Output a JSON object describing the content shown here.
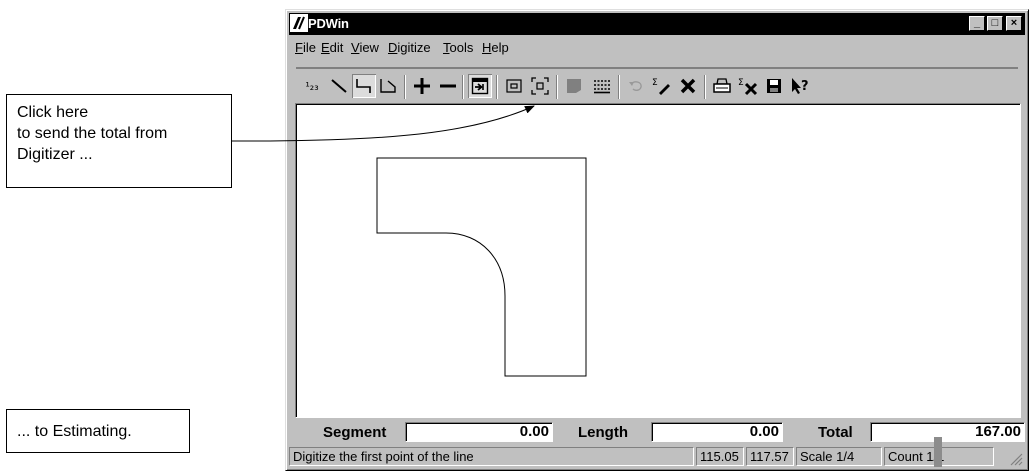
{
  "callouts": {
    "top": [
      "Click here",
      "to send the total from",
      "Digitizer ..."
    ],
    "bottom": "... to Estimating."
  },
  "window": {
    "title": "PDWin",
    "buttons": {
      "minimize": "_",
      "maximize": "□",
      "close": "×"
    }
  },
  "menu": [
    {
      "label": "File",
      "hotkey": "F"
    },
    {
      "label": "Edit",
      "hotkey": "E"
    },
    {
      "label": "View",
      "hotkey": "V"
    },
    {
      "label": "Digitize",
      "hotkey": "D"
    },
    {
      "label": "Tools",
      "hotkey": "T"
    },
    {
      "label": "Help",
      "hotkey": "H"
    }
  ],
  "toolbar": {
    "icons": [
      "count-icon",
      "line-icon",
      "segment-icon",
      "area-icon",
      "add-icon",
      "subtract-icon",
      "send-total-icon",
      "zoom-window-icon",
      "zoom-extents-icon",
      "fill-icon",
      "grid-icon",
      "undo-icon",
      "sum-clear-icon",
      "delete-icon",
      "print-icon",
      "sum-delete-icon",
      "save-icon",
      "help-icon"
    ],
    "count_label": "¹₂₃"
  },
  "measurements": {
    "segment_label": "Segment",
    "segment_value": "0.00",
    "length_label": "Length",
    "length_value": "0.00",
    "total_label": "Total",
    "total_value": "167.00"
  },
  "status": {
    "message": "Digitize the first point of the line",
    "x": "115.05",
    "y": "117.57",
    "scale": "Scale 1/4",
    "count": "Count 1/1"
  },
  "colors": {
    "titlebar": "#000000",
    "window": "#c0c0c0",
    "canvas": "#ffffff"
  }
}
